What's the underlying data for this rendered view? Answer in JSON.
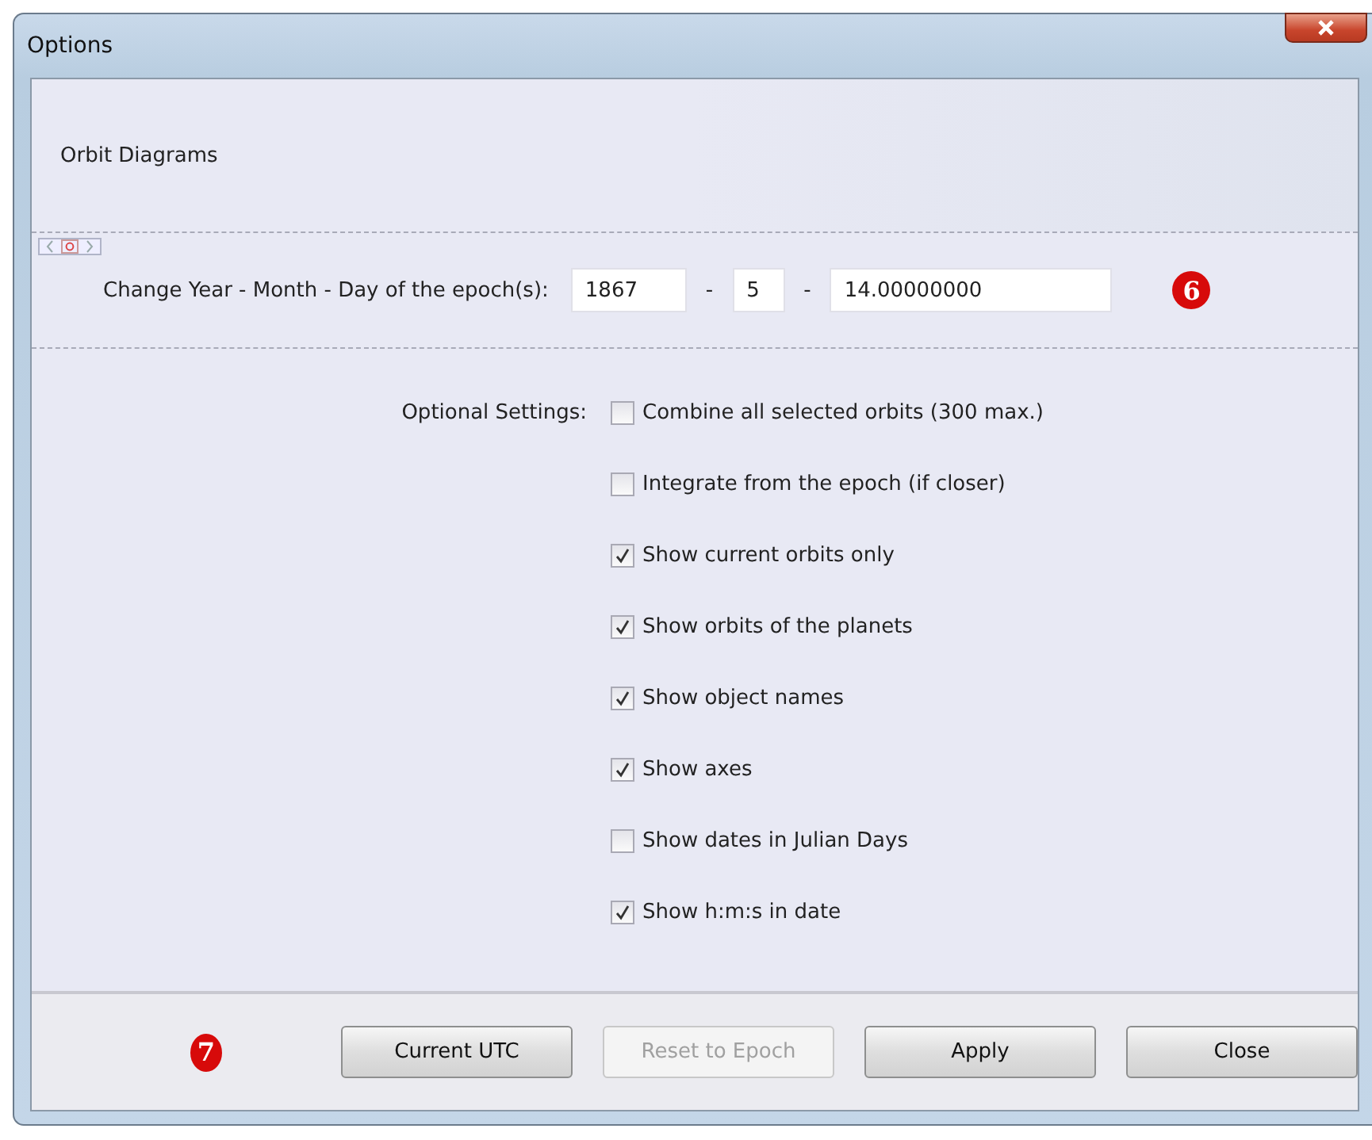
{
  "window": {
    "title": "Options"
  },
  "section": {
    "title": "Orbit Diagrams"
  },
  "epoch": {
    "label": "Change Year - Month - Day of the epoch(s):",
    "year": "1867",
    "separator_1": "-",
    "month": "5",
    "separator_2": "-",
    "day": "14.00000000",
    "badge": "6"
  },
  "optional_settings": {
    "label": "Optional Settings:",
    "items": [
      {
        "label": "Combine all selected orbits (300 max.)",
        "checked": false
      },
      {
        "label": "Integrate from the epoch (if closer)",
        "checked": false
      },
      {
        "label": "Show current orbits only",
        "checked": true
      },
      {
        "label": "Show orbits of the planets",
        "checked": true
      },
      {
        "label": "Show object names",
        "checked": true
      },
      {
        "label": "Show axes",
        "checked": true
      },
      {
        "label": "Show dates in Julian Days",
        "checked": false
      },
      {
        "label": "Show h:m:s in date",
        "checked": true
      }
    ]
  },
  "footer": {
    "badge": "7",
    "buttons": [
      {
        "label": "Current UTC",
        "disabled": false
      },
      {
        "label": "Reset to Epoch",
        "disabled": true
      },
      {
        "label": "Apply",
        "disabled": false
      },
      {
        "label": "Close",
        "disabled": false
      }
    ]
  }
}
